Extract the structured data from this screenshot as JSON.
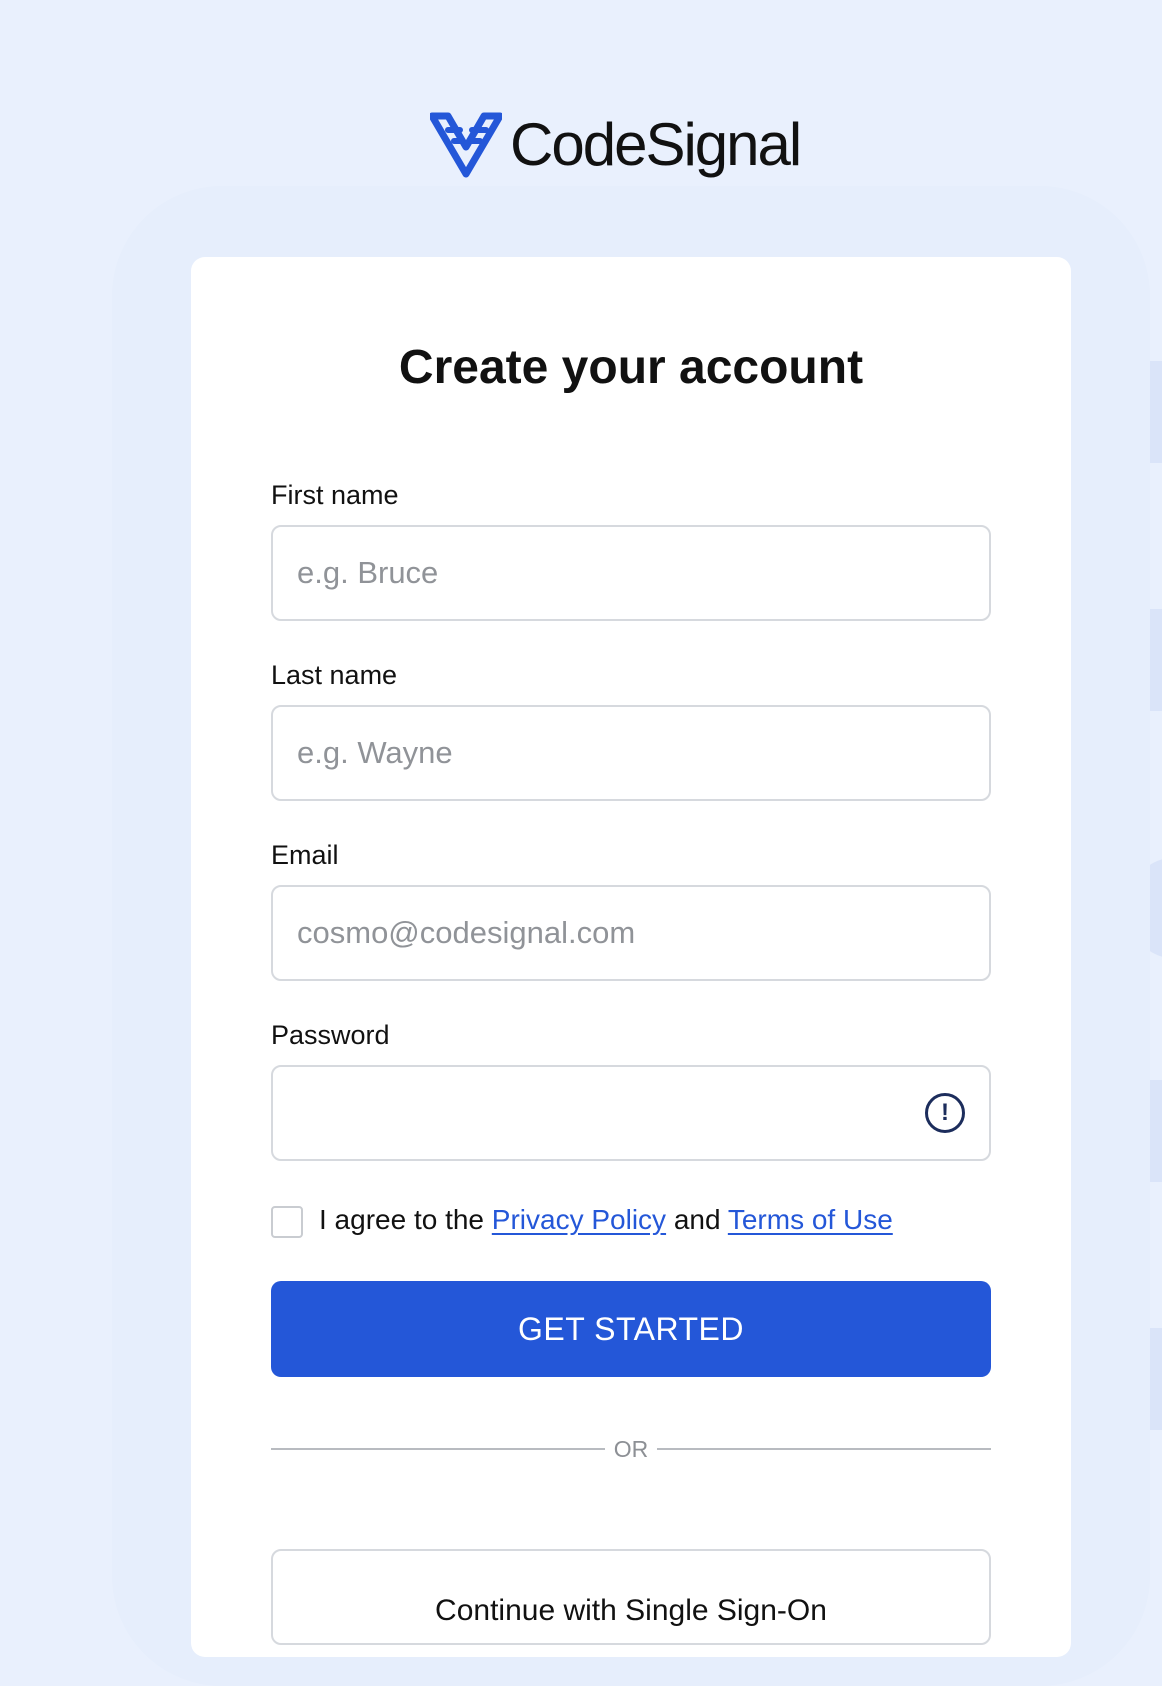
{
  "brand": {
    "name": "CodeSignal",
    "accent": "#2457d8"
  },
  "form": {
    "title": "Create your account",
    "first_name": {
      "label": "First name",
      "placeholder": "e.g. Bruce"
    },
    "last_name": {
      "label": "Last name",
      "placeholder": "e.g. Wayne"
    },
    "email": {
      "label": "Email",
      "placeholder": "cosmo@codesignal.com"
    },
    "password": {
      "label": "Password",
      "icon": "info-icon"
    },
    "agree": {
      "prefix": "I agree to the",
      "privacy_link": "Privacy Policy",
      "conjunction": "and",
      "terms_link": "Terms of Use",
      "checked": false
    },
    "submit_label": "GET STARTED",
    "divider_text": "OR",
    "sso_label": "Continue with Single Sign-On"
  }
}
